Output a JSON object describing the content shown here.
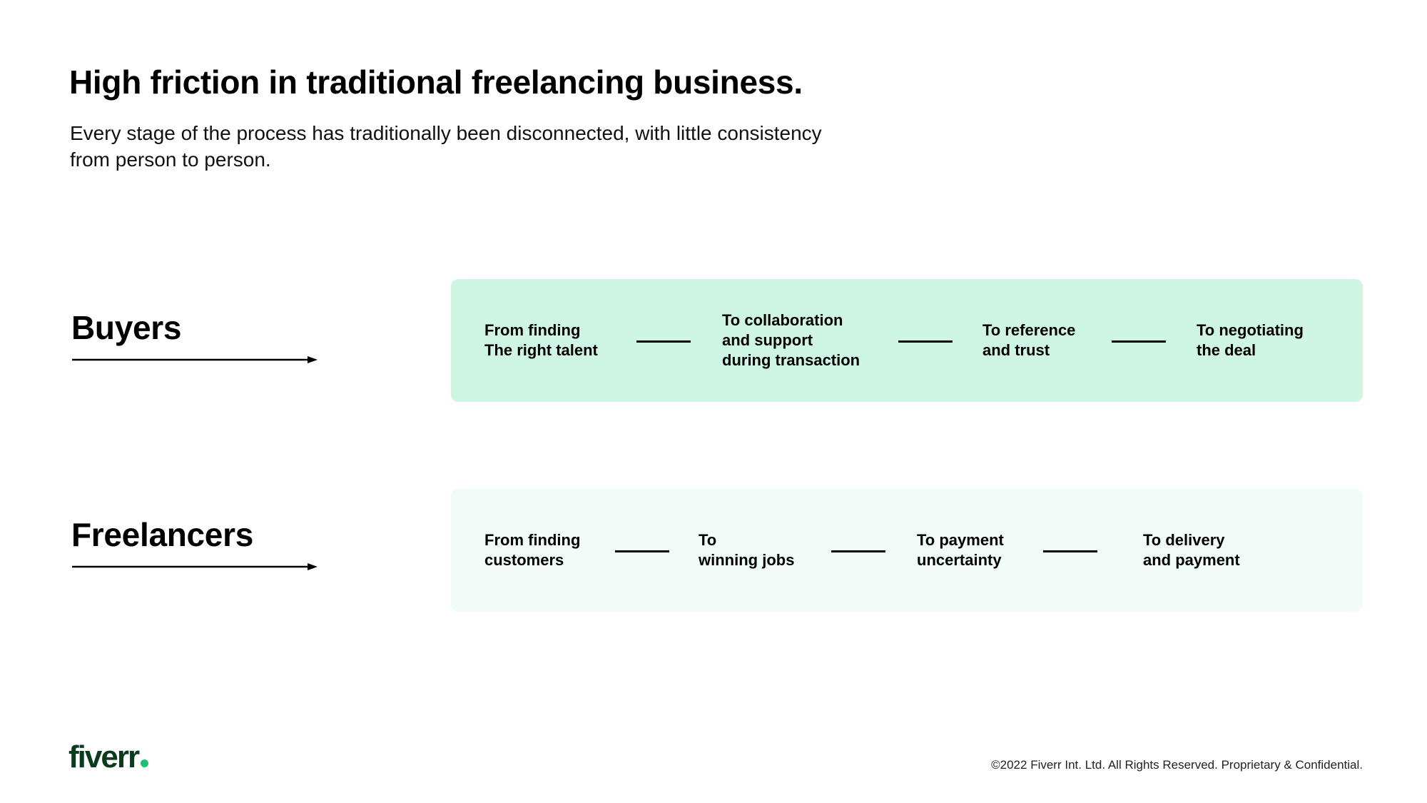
{
  "slide": {
    "title": "High friction in traditional freelancing business.",
    "subtitle": "Every stage of the process has traditionally been disconnected, with little consistency from person to person."
  },
  "rows": [
    {
      "label": "Buyers",
      "steps": [
        "From finding\nThe right talent",
        "To collaboration\nand support\nduring transaction",
        "To reference\nand trust",
        "To negotiating\nthe deal"
      ]
    },
    {
      "label": "Freelancers",
      "steps": [
        "From finding\ncustomers",
        "To\nwinning jobs",
        "To payment\nuncertainty",
        "To delivery\nand payment"
      ]
    }
  ],
  "colors": {
    "buyers_box": "#cff5e5",
    "freelancers_box": "#f1fcf8",
    "brand_dark": "#0a3b1f",
    "brand_green": "#1dbf73"
  },
  "footer": {
    "logo": "fiverr",
    "copyright": "©2022 Fiverr Int. Ltd. All Rights Reserved. Proprietary & Confidential."
  }
}
